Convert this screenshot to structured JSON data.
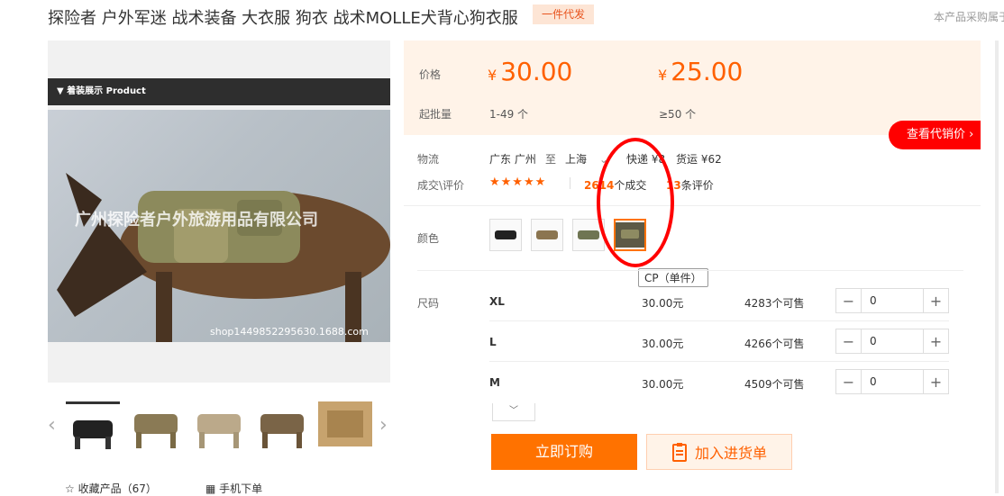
{
  "header": {
    "title": "探险者 户外军迷 战术装备 大衣服 狗衣 战术MOLLE犬背心狗衣服",
    "tag": "一件代发",
    "note": "本产品采购属于"
  },
  "gallery": {
    "banner": "▼ 着装展示 Product",
    "watermark": "广州探险者户外旅游用品有限公司",
    "shop_url": "shop1449852295630.1688.com",
    "prev_icon": "‹",
    "next_icon": "›",
    "favorite_label": "收藏产品（67）",
    "mobile_label": "手机下单"
  },
  "price": {
    "label": "价格",
    "currency": "¥",
    "tier1_price": "30.00",
    "tier2_price": "25.00",
    "moq_label": "起批量",
    "tier1_qty": "1-49 个",
    "tier2_qty": "≥50 个",
    "agent_price_button": "查看代销价 ›"
  },
  "logistics": {
    "label": "物流",
    "from": "广东 广州",
    "to_word": "至",
    "to": "上海",
    "express": "快递 ¥8",
    "freight": "货运 ¥62"
  },
  "reviews": {
    "label": "成交\\评价",
    "stars": "★★★★★",
    "deals_count": "2614",
    "deals_suffix": "个成交",
    "reviews_count": "13",
    "reviews_suffix": "条评价"
  },
  "color": {
    "label": "颜色",
    "tooltip": "CP（单件）"
  },
  "size": {
    "label": "尺码",
    "rows": [
      {
        "name": "XL",
        "price": "30.00元",
        "stock": "4283个可售",
        "qty": "0"
      },
      {
        "name": "L",
        "price": "30.00元",
        "stock": "4266个可售",
        "qty": "0"
      },
      {
        "name": "M",
        "price": "30.00元",
        "stock": "4509个可售",
        "qty": "0"
      }
    ]
  },
  "actions": {
    "buy_now": "立即订购",
    "add_to_list": "加入进货单"
  },
  "colors": {
    "accent": "#ff6000",
    "button": "#ff7200",
    "agent_button": "#ff0000",
    "annotation": "#ff0000"
  }
}
